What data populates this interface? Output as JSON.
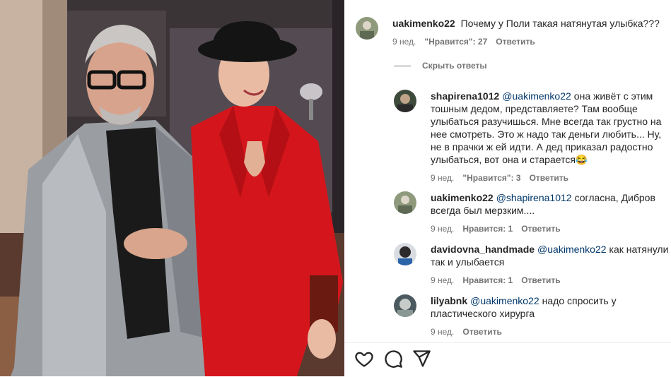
{
  "post_comment": {
    "username": "uakimenko22",
    "text": "Почему у Поли такая натянутая улыбка???",
    "time": "9 нед.",
    "likes": "\"Нравится\": 27",
    "reply": "Ответить"
  },
  "hide_replies_label": "Скрыть ответы",
  "replies": [
    {
      "username": "shapirena1012",
      "mention": "@uakimenko22",
      "lines": [
        "она живёт с этим",
        "тошным дедом, представляете? Там вообще",
        "улыбаться разучишься. Мне всегда так грустно на",
        "нее смотреть. Это ж надо так деньги любить... Ну,",
        "не в прачки ж ей идти. А дед приказал радостно",
        "улыбаться, вот она и старается😂"
      ],
      "time": "9 нед.",
      "likes": "\"Нравится\": 3",
      "reply": "Ответить"
    },
    {
      "username": "uakimenko22",
      "mention": "@shapirena1012",
      "lines": [
        "согласна, Дибров",
        "всегда был мерзким...."
      ],
      "time": "9 нед.",
      "likes": "Нравится: 1",
      "reply": "Ответить"
    },
    {
      "username": "davidovna_handmade",
      "mention": "@uakimenko22",
      "lines": [
        "как натянули",
        "так и улыбается"
      ],
      "time": "9 нед.",
      "likes": "Нравится: 1",
      "reply": "Ответить"
    },
    {
      "username": "lilyabnk",
      "mention": "@uakimenko22",
      "lines": [
        "надо спросить у",
        "пластического хирурга"
      ],
      "time": "9 нед.",
      "reply": "Ответить"
    }
  ],
  "icons": {
    "like": "heart-icon",
    "comment": "comment-bubble-icon",
    "share": "paper-plane-icon"
  },
  "colors": {
    "text": "#262626",
    "muted": "#737373",
    "mention": "#00376b",
    "red_suit": "#d4161c"
  }
}
